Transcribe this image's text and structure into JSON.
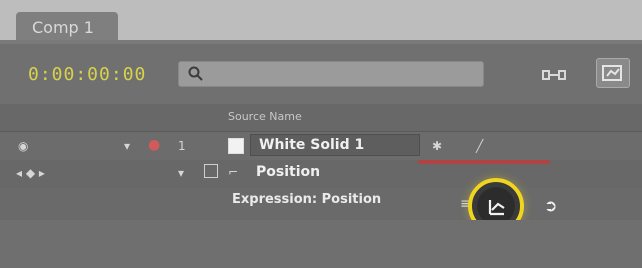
{
  "tab": {
    "label": "Comp 1"
  },
  "timecode": {
    "value": "0:00:00:00"
  },
  "search": {
    "placeholder": ""
  },
  "columns": {
    "source_name": "Source Name"
  },
  "layer": {
    "name": "White Solid 1"
  },
  "property": {
    "name": "Position"
  },
  "expression": {
    "label": "Expression: Position"
  },
  "colors": {
    "timecode": "#d7d24a",
    "pickwhip_ring": "#f0d520",
    "panel": "#6c6c6c",
    "tab": "#7f7f7f",
    "accent_red": "#b04444"
  },
  "icons": {
    "search": "magnifier-icon",
    "shy_layers": "comp-flowchart-icon",
    "graph_editor": "graph-editor-icon",
    "pickwhip": "expression-pickwhip-icon",
    "expression_graph": "expression-graph-icon",
    "stopwatch": "stopwatch-icon",
    "twirl_down": "twirl-down-icon",
    "eye": "eye-icon",
    "lock": "lock-icon"
  }
}
